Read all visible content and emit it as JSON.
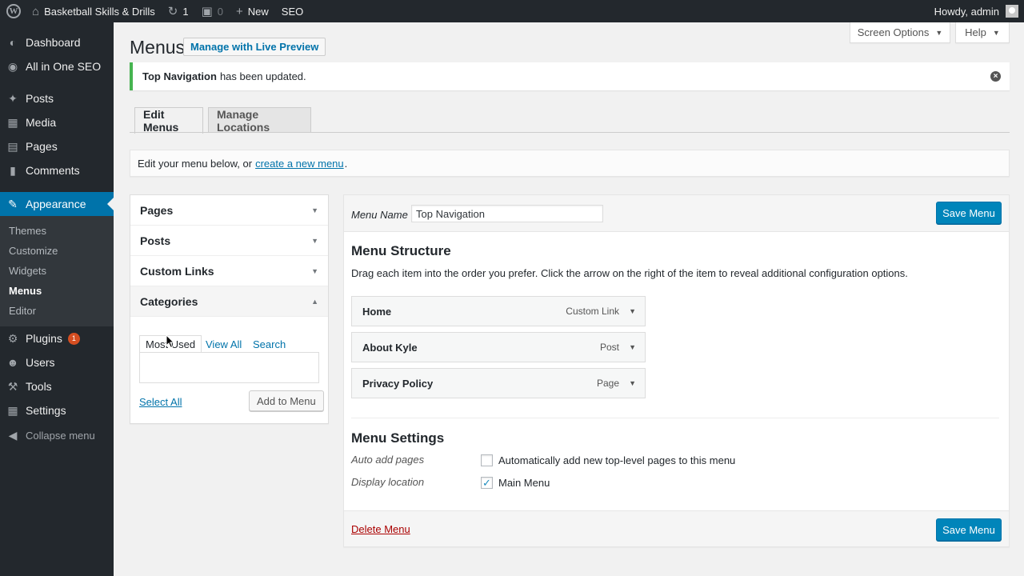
{
  "adminbar": {
    "site_name": "Basketball Skills & Drills",
    "updates_count": "1",
    "comments_count": "0",
    "new_label": "New",
    "seo_label": "SEO",
    "howdy": "Howdy, admin"
  },
  "sidebar": {
    "items": [
      {
        "label": "Dashboard",
        "icon": "dashboard-icon"
      },
      {
        "label": "All in One SEO",
        "icon": "seo-icon"
      },
      {
        "label": "Posts",
        "icon": "pin-icon"
      },
      {
        "label": "Media",
        "icon": "media-icon"
      },
      {
        "label": "Pages",
        "icon": "pages-icon"
      },
      {
        "label": "Comments",
        "icon": "comment-icon"
      },
      {
        "label": "Appearance",
        "icon": "brush-icon"
      },
      {
        "label": "Plugins",
        "icon": "plugin-icon",
        "badge": "1"
      },
      {
        "label": "Users",
        "icon": "user-icon"
      },
      {
        "label": "Tools",
        "icon": "wrench-icon"
      },
      {
        "label": "Settings",
        "icon": "settings-icon"
      }
    ],
    "submenu": [
      "Themes",
      "Customize",
      "Widgets",
      "Menus",
      "Editor"
    ],
    "collapse_label": "Collapse menu"
  },
  "header": {
    "title": "Menus",
    "live_preview": "Manage with Live Preview",
    "screen_options": "Screen Options",
    "help": "Help"
  },
  "notice": {
    "menu_name": "Top Navigation",
    "message": "has been updated."
  },
  "tabs": {
    "edit": "Edit Menus",
    "locations": "Manage Locations"
  },
  "manage": {
    "text_before": "Edit your menu below, or",
    "link": "create a new menu",
    "text_after": "."
  },
  "accordion": {
    "sections": [
      "Pages",
      "Posts",
      "Custom Links",
      "Categories"
    ],
    "category_tabs": [
      "Most Used",
      "View All",
      "Search"
    ],
    "select_all": "Select All",
    "add_to_menu": "Add to Menu"
  },
  "menu": {
    "name_label": "Menu Name",
    "name_value": "Top Navigation",
    "save_label": "Save Menu",
    "structure_title": "Menu Structure",
    "structure_desc": "Drag each item into the order you prefer. Click the arrow on the right of the item to reveal additional configuration options.",
    "items": [
      {
        "title": "Home",
        "type": "Custom Link"
      },
      {
        "title": "About Kyle",
        "type": "Post"
      },
      {
        "title": "Privacy Policy",
        "type": "Page"
      }
    ],
    "settings_title": "Menu Settings",
    "auto_add_label": "Auto add pages",
    "auto_add_text": "Automatically add new top-level pages to this menu",
    "auto_add_checked": false,
    "display_label": "Display location",
    "display_text": "Main Menu",
    "display_checked": true,
    "delete_label": "Delete Menu"
  },
  "colors": {
    "accent": "#0073aa",
    "button": "#0085ba",
    "sidebar": "#23282d",
    "success": "#46b450",
    "delete": "#aa0000"
  }
}
